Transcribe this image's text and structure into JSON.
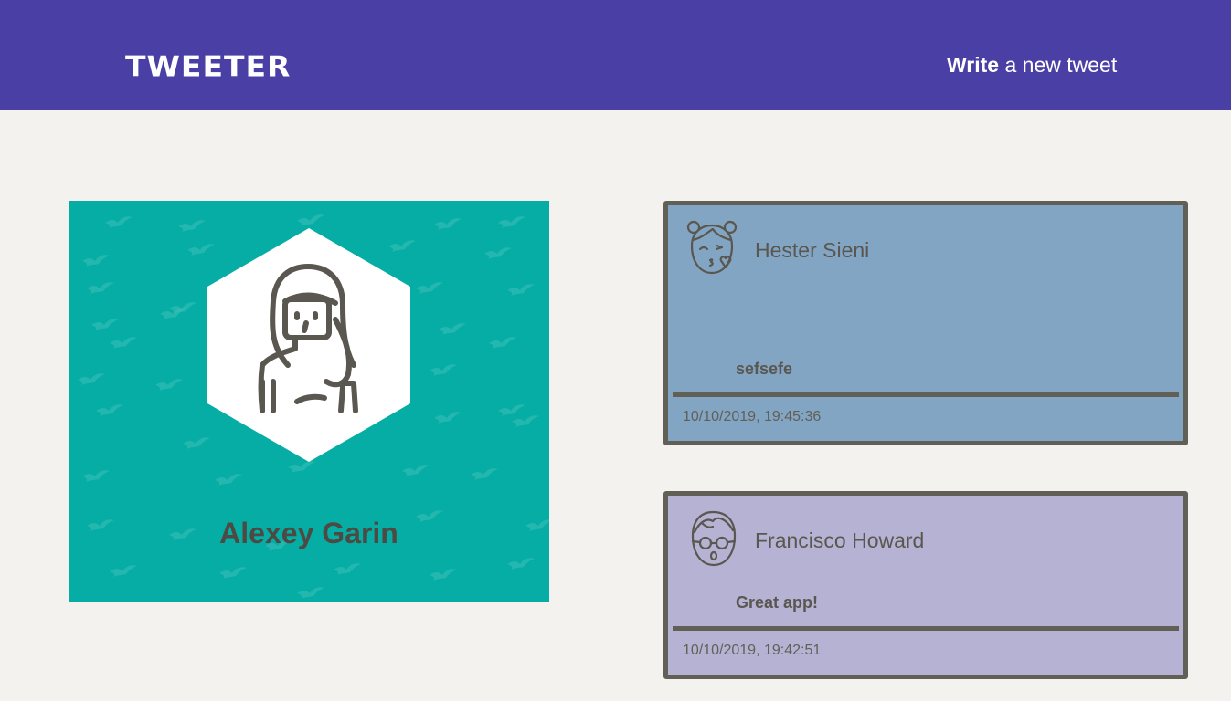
{
  "header": {
    "brand": "TWEETER",
    "write_bold": "Write",
    "write_rest": " a new tweet"
  },
  "profile": {
    "name": "Alexey Garin",
    "avatar_icon": "woman-avatar-icon"
  },
  "tweets": [
    {
      "author": "Hester Sieni",
      "avatar_icon": "girl-kiss-avatar-icon",
      "text": "sefsefe",
      "timestamp": "10/10/2019, 19:45:36"
    },
    {
      "author": "Francisco Howard",
      "avatar_icon": "boy-glasses-avatar-icon",
      "text": "Great app!",
      "timestamp": "10/10/2019, 19:42:51"
    }
  ],
  "colors": {
    "navbar": "#4a3fa5",
    "page_background": "#f3f2ee",
    "profile_card": "#05ada4",
    "tweet_1_background": "#82a5c3",
    "tweet_2_background": "#b6b2d3",
    "border": "#625f57"
  }
}
